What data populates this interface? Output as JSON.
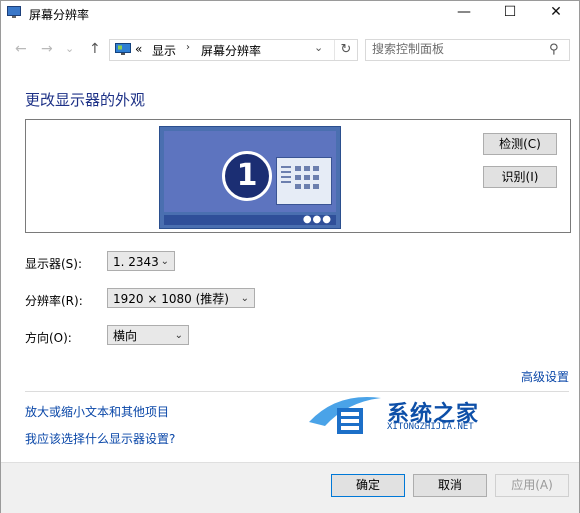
{
  "window": {
    "title": "屏幕分辨率"
  },
  "controls": {
    "minimize": "—",
    "maximize": "☐",
    "close": "✕"
  },
  "nav": {
    "back": "←",
    "forward": "→",
    "recent": "⌄",
    "up": "↑",
    "breadcrumb_prefix": "«",
    "breadcrumbs": [
      "显示",
      "屏幕分辨率"
    ],
    "breadcrumb_sep": "›",
    "address_dropdown": "⌄",
    "refresh": "↻"
  },
  "search": {
    "placeholder": "搜索控制面板",
    "icon": "search-icon"
  },
  "main": {
    "heading": "更改显示器的外观",
    "monitor_number": "1",
    "detect_button": "检测(C)",
    "identify_button": "识别(I)",
    "display_label": "显示器(S):",
    "display_value": "1. 2343",
    "resolution_label": "分辨率(R):",
    "resolution_value": "1920 × 1080 (推荐)",
    "orientation_label": "方向(O):",
    "orientation_value": "横向",
    "advanced_link": "高级设置",
    "link_text_size": "放大或缩小文本和其他项目",
    "link_which_settings": "我应该选择什么显示器设置?"
  },
  "footer": {
    "ok": "确定",
    "cancel": "取消",
    "apply": "应用(A)"
  },
  "watermark": {
    "name": "系统之家",
    "url": "XITONGZHIJIA.NET"
  },
  "colors": {
    "heading": "#1e3287",
    "link": "#0a47a8",
    "monitor": "#5d74bf"
  }
}
